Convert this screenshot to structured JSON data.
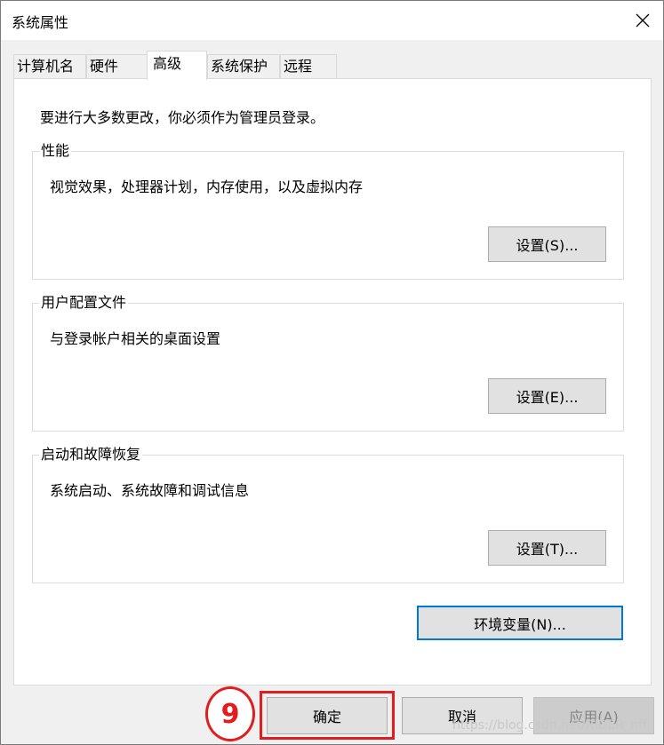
{
  "window": {
    "title": "系统属性",
    "close_icon": "close-icon"
  },
  "tabs": [
    {
      "label": "计算机名",
      "active": false
    },
    {
      "label": "硬件",
      "active": false
    },
    {
      "label": "高级",
      "active": true
    },
    {
      "label": "系统保护",
      "active": false
    },
    {
      "label": "远程",
      "active": false
    }
  ],
  "panel": {
    "admin_note": "要进行大多数更改，你必须作为管理员登录。",
    "groups": [
      {
        "legend": "性能",
        "description": "视觉效果，处理器计划，内存使用，以及虚拟内存",
        "button": "设置(S)..."
      },
      {
        "legend": "用户配置文件",
        "description": "与登录帐户相关的桌面设置",
        "button": "设置(E)..."
      },
      {
        "legend": "启动和故障恢复",
        "description": "系统启动、系统故障和调试信息",
        "button": "设置(T)..."
      }
    ],
    "env_button": "环境变量(N)..."
  },
  "footer": {
    "ok": "确定",
    "cancel": "取消",
    "apply": "应用(A)"
  },
  "annotation": {
    "step_number": "9",
    "color": "#e11d1d"
  },
  "watermark": "https://blog.csdn.net/RIDER_hff",
  "colors": {
    "accent_border": "#0078d7",
    "button_bg": "#e1e1e1",
    "disabled_text": "#838383"
  }
}
